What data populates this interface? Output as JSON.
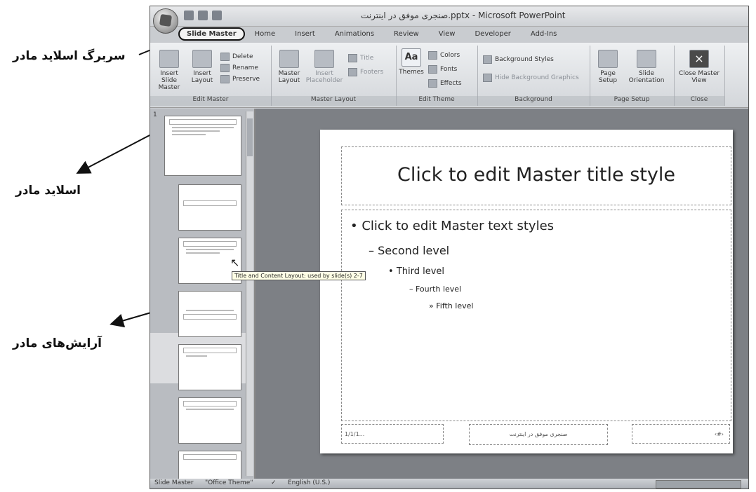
{
  "annotations": {
    "slide_master_tab": "سربرگ اسلاید مادر",
    "slide_master": "اسلاید مادر",
    "master_layouts": "آرایش‌های مادر"
  },
  "window": {
    "title": "صنجری موفق در اینترنت.pptx - Microsoft PowerPoint"
  },
  "tabs": [
    "Slide Master",
    "Home",
    "Insert",
    "Animations",
    "Review",
    "View",
    "Developer",
    "Add-Ins"
  ],
  "ribbon": {
    "insert_slide_master": "Insert Slide Master",
    "insert_layout": "Insert Layout",
    "delete": "Delete",
    "rename": "Rename",
    "preserve": "Preserve",
    "edit_master_group": "Edit Master",
    "master_layout_btn": "Master Layout",
    "insert_placeholder": "Insert Placeholder",
    "title_chk": "Title",
    "footers_chk": "Footers",
    "master_layout_group": "Master Layout",
    "themes": "Themes",
    "colors": "Colors",
    "fonts": "Fonts",
    "effects": "Effects",
    "edit_theme_group": "Edit Theme",
    "background_styles": "Background Styles",
    "hide_bg_graphics": "Hide Background Graphics",
    "background_group": "Background",
    "page_setup": "Page Setup",
    "slide_orientation": "Slide Orientation",
    "page_setup_group": "Page Setup",
    "close_master_view": "Close Master View",
    "close_group": "Close"
  },
  "thumbnails": {
    "first_number": "1",
    "tooltip": "Title and Content Layout: used by slide(s) 2-7"
  },
  "slide": {
    "title": "Click to edit Master title style",
    "level1": "Click to edit Master text styles",
    "level2": "Second level",
    "level3": "Third level",
    "level4": "Fourth level",
    "level5": "Fifth level",
    "bullet1": "•",
    "bullet2": "–",
    "bullet3": "•",
    "bullet4": "–",
    "bullet5": "»",
    "date": "1/1/1...",
    "footer": "صنجری موفق در اینترنت",
    "number": "‹#›"
  },
  "status": {
    "view": "Slide Master",
    "theme": "\"Office Theme\"",
    "language": "English (U.S.)"
  }
}
